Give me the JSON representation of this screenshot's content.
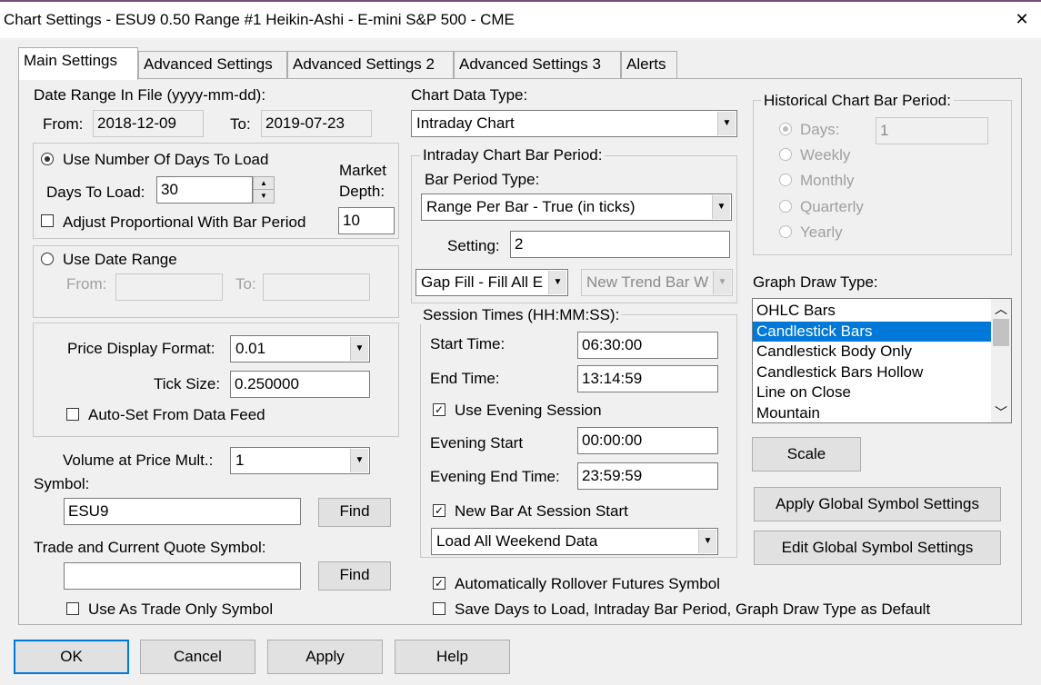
{
  "window": {
    "title": "Chart Settings - ESU9  0.50 Range  #1 Heikin-Ashi - E-mini S&P 500 - CME",
    "close_glyph": "✕"
  },
  "tabs": [
    "Main Settings",
    "Advanced Settings",
    "Advanced Settings 2",
    "Advanced Settings 3",
    "Alerts"
  ],
  "date_range": {
    "header": "Date Range In File (yyyy-mm-dd):",
    "from_label": "From:",
    "from_value": "2018-12-09",
    "to_label": "To:",
    "to_value": "2019-07-23"
  },
  "days": {
    "use_days_label": "Use Number Of Days To Load",
    "days_label": "Days To Load:",
    "days_value": "30",
    "market_depth_label1": "Market",
    "market_depth_label2": "Depth:",
    "market_depth_value": "10",
    "adjust_label": "Adjust Proportional With Bar Period"
  },
  "use_date_range": {
    "label": "Use Date Range",
    "from_label": "From:",
    "to_label": "To:",
    "from_value": "",
    "to_value": ""
  },
  "price": {
    "format_label": "Price Display Format:",
    "format_value": "0.01",
    "tick_label": "Tick Size:",
    "tick_value": "0.250000",
    "autoset_label": "Auto-Set From Data Feed"
  },
  "volume": {
    "label": "Volume at Price Mult.:",
    "value": "1"
  },
  "symbol": {
    "label": "Symbol:",
    "value": "ESU9",
    "find_label": "Find"
  },
  "trade_symbol": {
    "label": "Trade and Current Quote Symbol:",
    "value": "",
    "find_label": "Find",
    "trade_only_label": "Use As Trade Only Symbol"
  },
  "chart_data_type": {
    "label": "Chart Data Type:",
    "value": "Intraday Chart"
  },
  "intraday": {
    "group_title": "Intraday Chart Bar Period:",
    "bar_type_label": "Bar Period Type:",
    "bar_type_value": "Range Per Bar - True (in ticks)",
    "setting_label": "Setting:",
    "setting_value": "2",
    "gap_fill_value": "Gap Fill - Fill All E",
    "new_trend_value": "New Trend Bar W"
  },
  "session": {
    "group_title": "Session Times (HH:MM:SS):",
    "start_label": "Start Time:",
    "start_value": "06:30:00",
    "end_label": "End Time:",
    "end_value": "13:14:59",
    "use_evening_label": "Use Evening Session",
    "evening_start_label": "Evening Start",
    "evening_start_value": "00:00:00",
    "evening_end_label": "Evening End Time:",
    "evening_end_value": "23:59:59",
    "new_bar_label": "New Bar At Session Start",
    "weekend_value": "Load All Weekend Data"
  },
  "historical": {
    "group_title": "Historical Chart Bar Period:",
    "days_label": "Days:",
    "days_value": "1",
    "weekly": "Weekly",
    "monthly": "Monthly",
    "quarterly": "Quarterly",
    "yearly": "Yearly"
  },
  "graph_draw": {
    "label": "Graph Draw Type:",
    "items": [
      "OHLC Bars",
      "Candlestick Bars",
      "Candlestick Body Only",
      "Candlestick Bars Hollow",
      "Line on Close",
      "Mountain"
    ],
    "selected_index": 1
  },
  "buttons": {
    "scale": "Scale",
    "apply_global": "Apply Global Symbol Settings",
    "edit_global": "Edit Global Symbol Settings",
    "ok": "OK",
    "cancel": "Cancel",
    "apply": "Apply",
    "help": "Help"
  },
  "rollover_label": "Automatically Rollover Futures Symbol",
  "save_default_label": "Save Days to Load, Intraday Bar Period, Graph Draw Type as Default",
  "glyphs": {
    "check": "✓",
    "dropdown": "▼",
    "spin_up": "▲",
    "spin_down": "▼",
    "scroll_up": "︿",
    "scroll_down": "﹀"
  }
}
